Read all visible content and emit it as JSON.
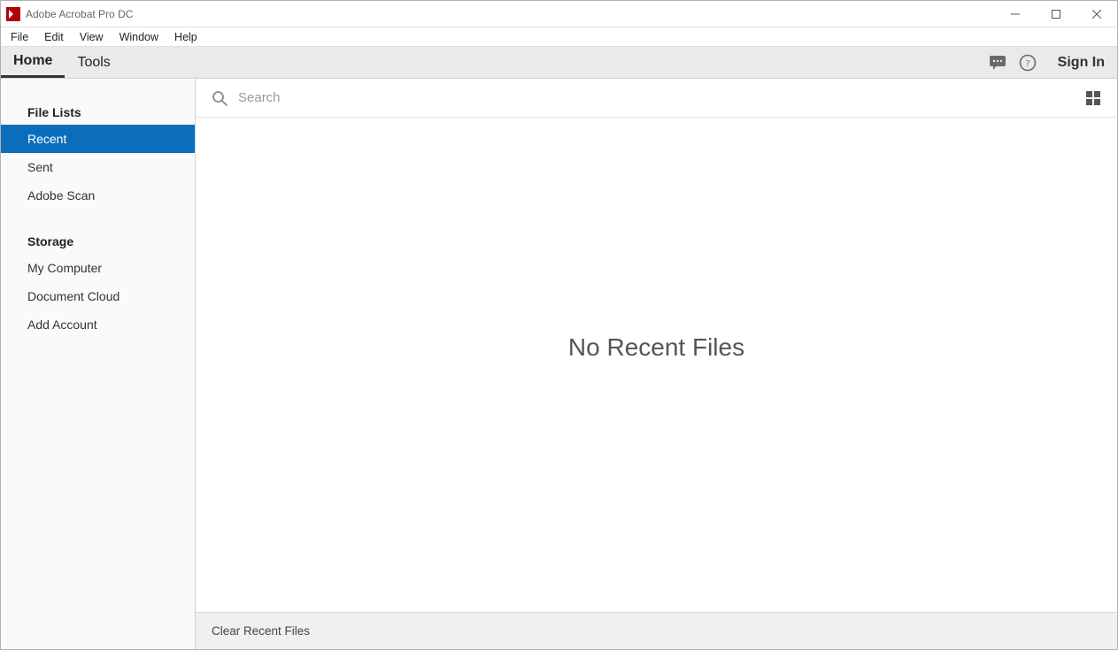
{
  "titlebar": {
    "title": "Adobe Acrobat Pro DC"
  },
  "menubar": {
    "items": [
      "File",
      "Edit",
      "View",
      "Window",
      "Help"
    ]
  },
  "tabbar": {
    "tabs": [
      {
        "label": "Home",
        "active": true
      },
      {
        "label": "Tools",
        "active": false
      }
    ],
    "signin_label": "Sign In"
  },
  "sidebar": {
    "section1_label": "File Lists",
    "file_lists": [
      {
        "label": "Recent",
        "selected": true
      },
      {
        "label": "Sent",
        "selected": false
      },
      {
        "label": "Adobe Scan",
        "selected": false
      }
    ],
    "section2_label": "Storage",
    "storage": [
      {
        "label": "My Computer"
      },
      {
        "label": "Document Cloud"
      },
      {
        "label": "Add Account"
      }
    ]
  },
  "search": {
    "placeholder": "Search",
    "value": ""
  },
  "main": {
    "empty_message": "No Recent Files"
  },
  "footer": {
    "clear_label": "Clear Recent Files"
  }
}
